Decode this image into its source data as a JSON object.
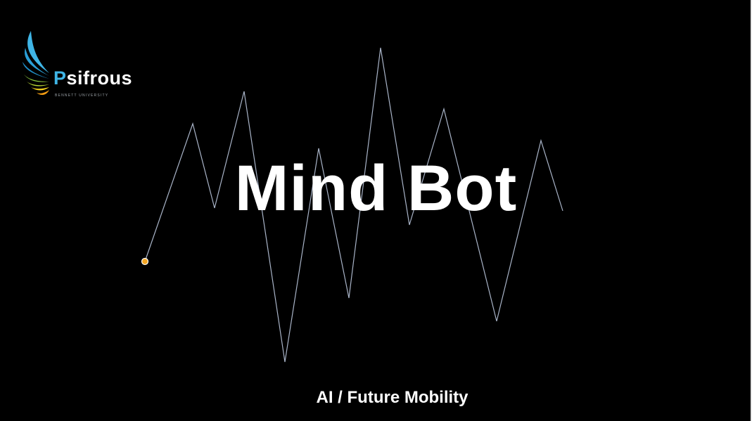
{
  "logo": {
    "first_letter": "P",
    "rest": "sifrous",
    "subtext": "BENNETT UNIVERSITY"
  },
  "slide": {
    "title": "Mind Bot",
    "subtitle": "AI / Future Mobility"
  },
  "colors": {
    "background": "#000000",
    "wave_line": "#a9b4c8",
    "dot": "#f5a623",
    "logo_blue": "#3fb5e6",
    "logo_green": "#8cc63f",
    "logo_yellow": "#f7d51d",
    "logo_orange": "#f39c12"
  }
}
